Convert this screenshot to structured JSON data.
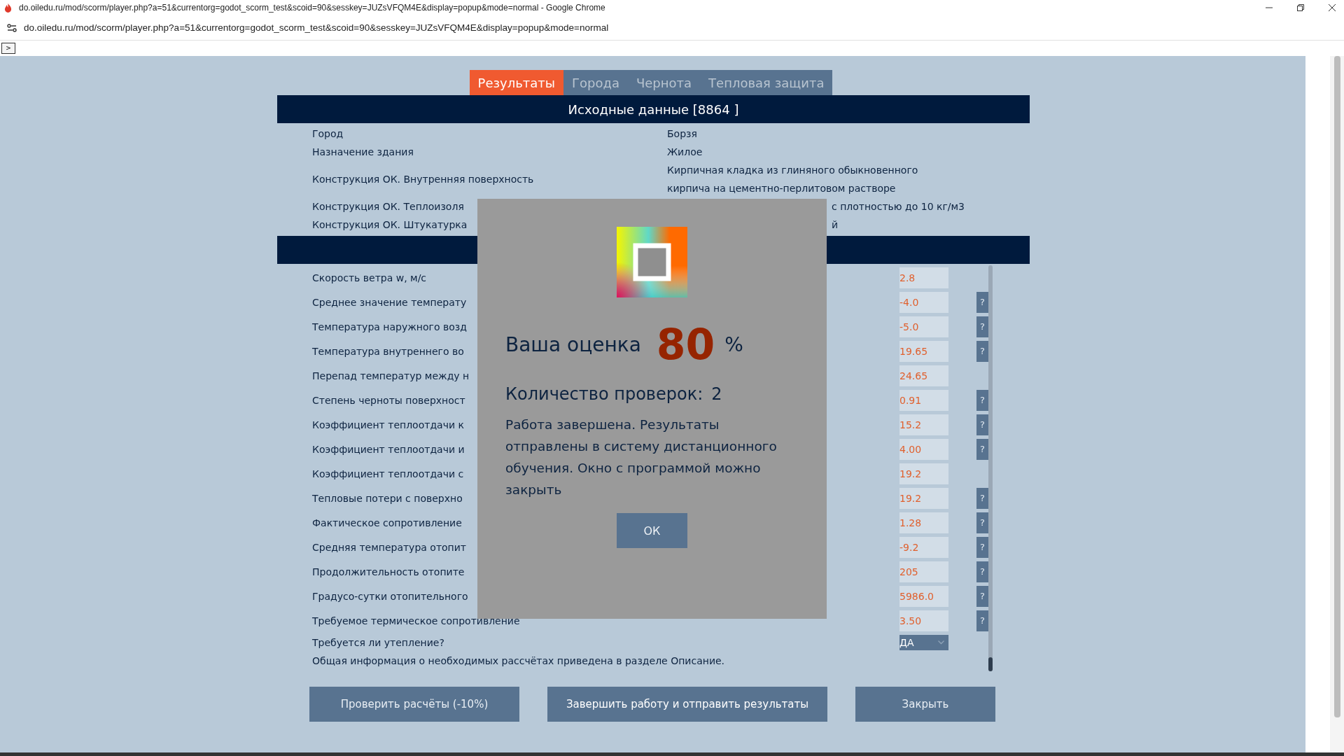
{
  "browser": {
    "title": "do.oiledu.ru/mod/scorm/player.php?a=51&currentorg=godot_scorm_test&scoid=90&sesskey=JUZsVFQM4E&display=popup&mode=normal - Google Chrome",
    "url": "do.oiledu.ru/mod/scorm/player.php?a=51&currentorg=godot_scorm_test&scoid=90&sesskey=JUZsVFQM4E&display=popup&mode=normal"
  },
  "toggle": ">",
  "tabs": [
    {
      "label": "Результаты",
      "selected": true
    },
    {
      "label": "Города",
      "selected": false
    },
    {
      "label": "Чернота",
      "selected": false
    },
    {
      "label": "Тепловая защита",
      "selected": false
    }
  ],
  "source_data": {
    "title": "Исходные данные [8864 ]",
    "rows": [
      {
        "label": "Город",
        "value": "Борзя",
        "kind": "full"
      },
      {
        "label": "Назначение здания",
        "value": "Жилое",
        "kind": "full"
      },
      {
        "label": "Конструкция ОК. Внутренняя поверхность",
        "value_lines": [
          "Кирпичная кладка из глиняного обыкновенного",
          "кирпича на цементно-перлитовом растворе"
        ],
        "kind": "full"
      },
      {
        "label": "Конструкция ОК. Теплоизоля",
        "value": "с плотностью до 10 кг/м3",
        "kind": "partial"
      },
      {
        "label": "Конструкция ОК. Штукатурка",
        "value": "й",
        "kind": "partial"
      }
    ]
  },
  "parameters": [
    {
      "label": "Скорость ветра w, м/с",
      "value": "2.8",
      "kind": "input"
    },
    {
      "label": "Среднее значение температу",
      "value": "-4.0",
      "kind": "input",
      "help": "?"
    },
    {
      "label": "Температура наружного возд",
      "value": "-5.0",
      "kind": "input",
      "help": "?"
    },
    {
      "label": "Температура внутреннего во",
      "value": "19.65",
      "kind": "input",
      "help": "?"
    },
    {
      "label": "Перепад температур между н",
      "value": "24.65",
      "kind": "input"
    },
    {
      "label": "Степень черноты поверхност",
      "value": "0.91",
      "kind": "input",
      "help": "?"
    },
    {
      "label": "Коэффициент теплоотдачи к",
      "value": "15.2",
      "kind": "input",
      "help": "?"
    },
    {
      "label": "Коэффициент теплоотдачи и",
      "value": "4.00",
      "kind": "input",
      "help": "?"
    },
    {
      "label": "Коэффициент теплоотдачи с",
      "value": "19.2",
      "kind": "input"
    },
    {
      "label": "Тепловые потери с поверхно",
      "value": "19.2",
      "kind": "input",
      "help": "?"
    },
    {
      "label": "Фактическое сопротивление",
      "value": "1.28",
      "kind": "input",
      "help": "?"
    },
    {
      "label": "Средняя температура отопит",
      "value": "-9.2",
      "kind": "input",
      "help": "?"
    },
    {
      "label": "Продолжительность отопите",
      "value": "205",
      "kind": "input",
      "help": "?"
    },
    {
      "label": "Градусо-сутки отопительного",
      "value": "5986.0",
      "kind": "input",
      "help": "?"
    },
    {
      "label": "Требуемое термическое сопротивление",
      "value": "3.50",
      "kind": "input",
      "help": "?"
    },
    {
      "label": "Требуется ли утепление?",
      "value": "ДА",
      "kind": "select"
    }
  ],
  "note": "Общая информация о необходимых рассчётах приведена в разделе Описание.",
  "buttons": [
    "Проверить расчёты (-10%)",
    "Завершить работу и отправить результаты",
    "Закрыть"
  ],
  "dialog": {
    "score_label": "Ваша оценка",
    "score": "80",
    "percent": "%",
    "checks_label": "Количество проверок:",
    "checks": "2",
    "message": "Работа завершена. Результаты отправлены в систему дистанционного обучения. Окно с программой можно закрыть",
    "ok": "ОК"
  }
}
